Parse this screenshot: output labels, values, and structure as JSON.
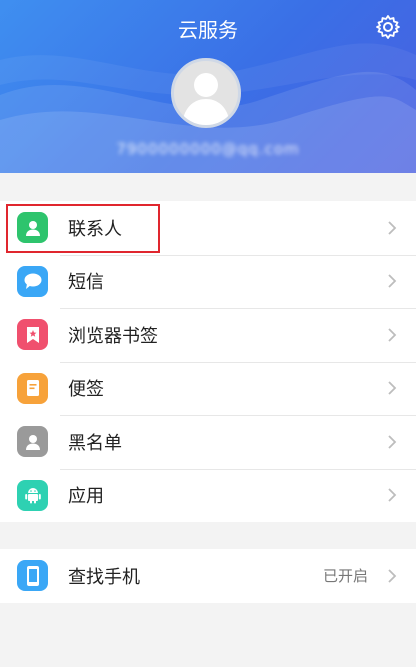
{
  "header": {
    "title": "云服务",
    "account": "7900000000@qq.com"
  },
  "menu": [
    {
      "label": "联系人",
      "icon": "contacts-icon",
      "color": "#2ec46d"
    },
    {
      "label": "短信",
      "icon": "sms-icon",
      "color": "#3aa7f6"
    },
    {
      "label": "浏览器书签",
      "icon": "bookmark-icon",
      "color": "#f0506e"
    },
    {
      "label": "便签",
      "icon": "note-icon",
      "color": "#f7a23a"
    },
    {
      "label": "黑名单",
      "icon": "blacklist-icon",
      "color": "#9a9a9a"
    },
    {
      "label": "应用",
      "icon": "android-icon",
      "color": "#2ed1b2"
    }
  ],
  "find_phone": {
    "label": "查找手机",
    "status": "已开启",
    "icon": "phone-icon",
    "color": "#3aa7f6"
  },
  "colors": {
    "header_gradient_start": "#3f8ff0",
    "header_gradient_end": "#4a5fe0",
    "highlight": "#e0262e"
  }
}
